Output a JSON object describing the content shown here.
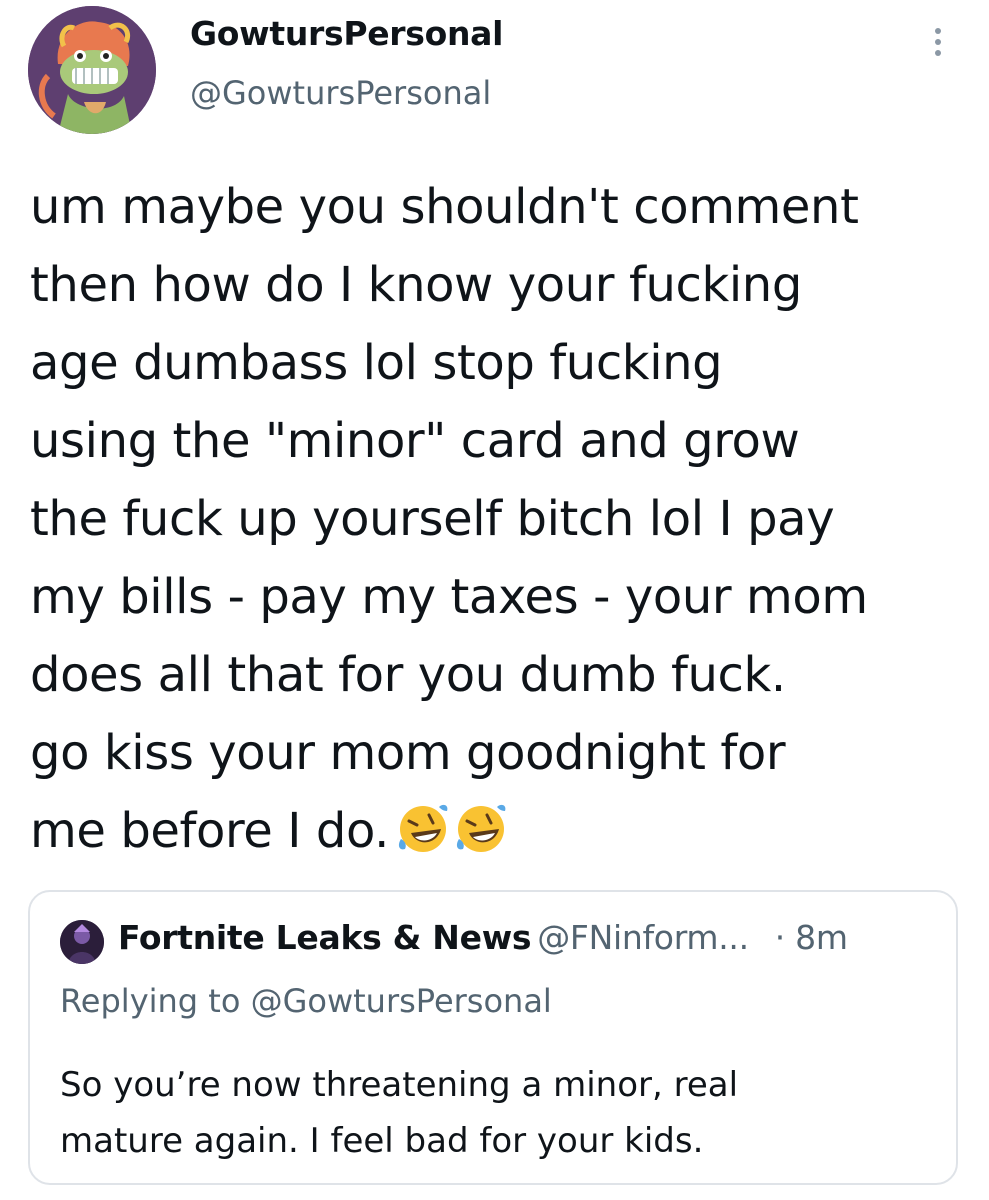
{
  "tweet": {
    "display_name": "GowtursPersonal",
    "handle": "@GowtursPersonal",
    "avatar_icon": "cartoon-avatar-icon",
    "more_icon": "more-options-icon",
    "text_lines": [
      "um maybe you shouldn't comment",
      "then how do I know your fucking",
      "age dumbass lol stop fucking",
      "using the \"minor\" card and grow",
      "the fuck up yourself bitch lol I pay",
      "my bills - pay my taxes - your mom",
      "does all that for you dumb fuck.",
      "go kiss your mom goodnight for",
      "me before I do."
    ],
    "emojis": [
      "rolling-on-floor-laughing-emoji",
      "rolling-on-floor-laughing-emoji"
    ]
  },
  "quoted_tweet": {
    "avatar_icon": "fortnite-avatar-icon",
    "display_name": "Fortnite Leaks & News",
    "handle": "@FNinform...",
    "time": "· 8m",
    "replying_to": "Replying to @GowtursPersonal",
    "text_lines": [
      "So you’re now threatening a minor, real",
      "mature again. I feel bad for your kids."
    ]
  },
  "colors": {
    "text": "#0f1419",
    "secondary_text": "#536471",
    "border": "#dfe3e8",
    "emoji_yellow": "#f9c232"
  }
}
